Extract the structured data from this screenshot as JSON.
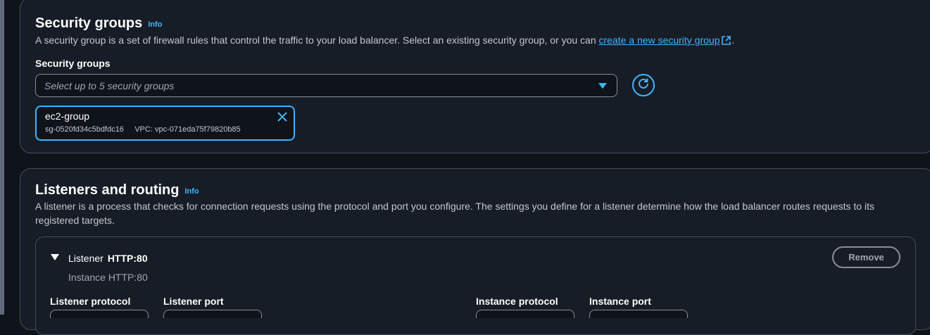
{
  "security_groups": {
    "title": "Security groups",
    "info_label": "Info",
    "description_prefix": "A security group is a set of firewall rules that control the traffic to your load balancer. Select an existing security group, or you can ",
    "description_link": "create a new security group",
    "description_suffix": ".",
    "field_label": "Security groups",
    "select_placeholder": "Select up to 5 security groups",
    "selected": [
      {
        "name": "ec2-group",
        "id": "sg-0520fd34c5bdfdc16",
        "vpc": "VPC: vpc-071eda75f79820b85"
      }
    ]
  },
  "listeners_routing": {
    "title": "Listeners and routing",
    "info_label": "Info",
    "description": "A listener is a process that checks for connection requests using the protocol and port you configure. The settings you define for a listener determine how the load balancer routes requests to its registered targets.",
    "listener": {
      "label": "Listener",
      "name": "HTTP:80",
      "subtitle": "Instance HTTP:80",
      "remove_label": "Remove",
      "fields": {
        "listener_protocol": "Listener protocol",
        "listener_port": "Listener port",
        "instance_protocol": "Instance protocol",
        "instance_port": "Instance port"
      }
    }
  },
  "colors": {
    "accent": "#42b4ff",
    "panel_bg": "#161d26",
    "page_bg": "#0f141a"
  }
}
